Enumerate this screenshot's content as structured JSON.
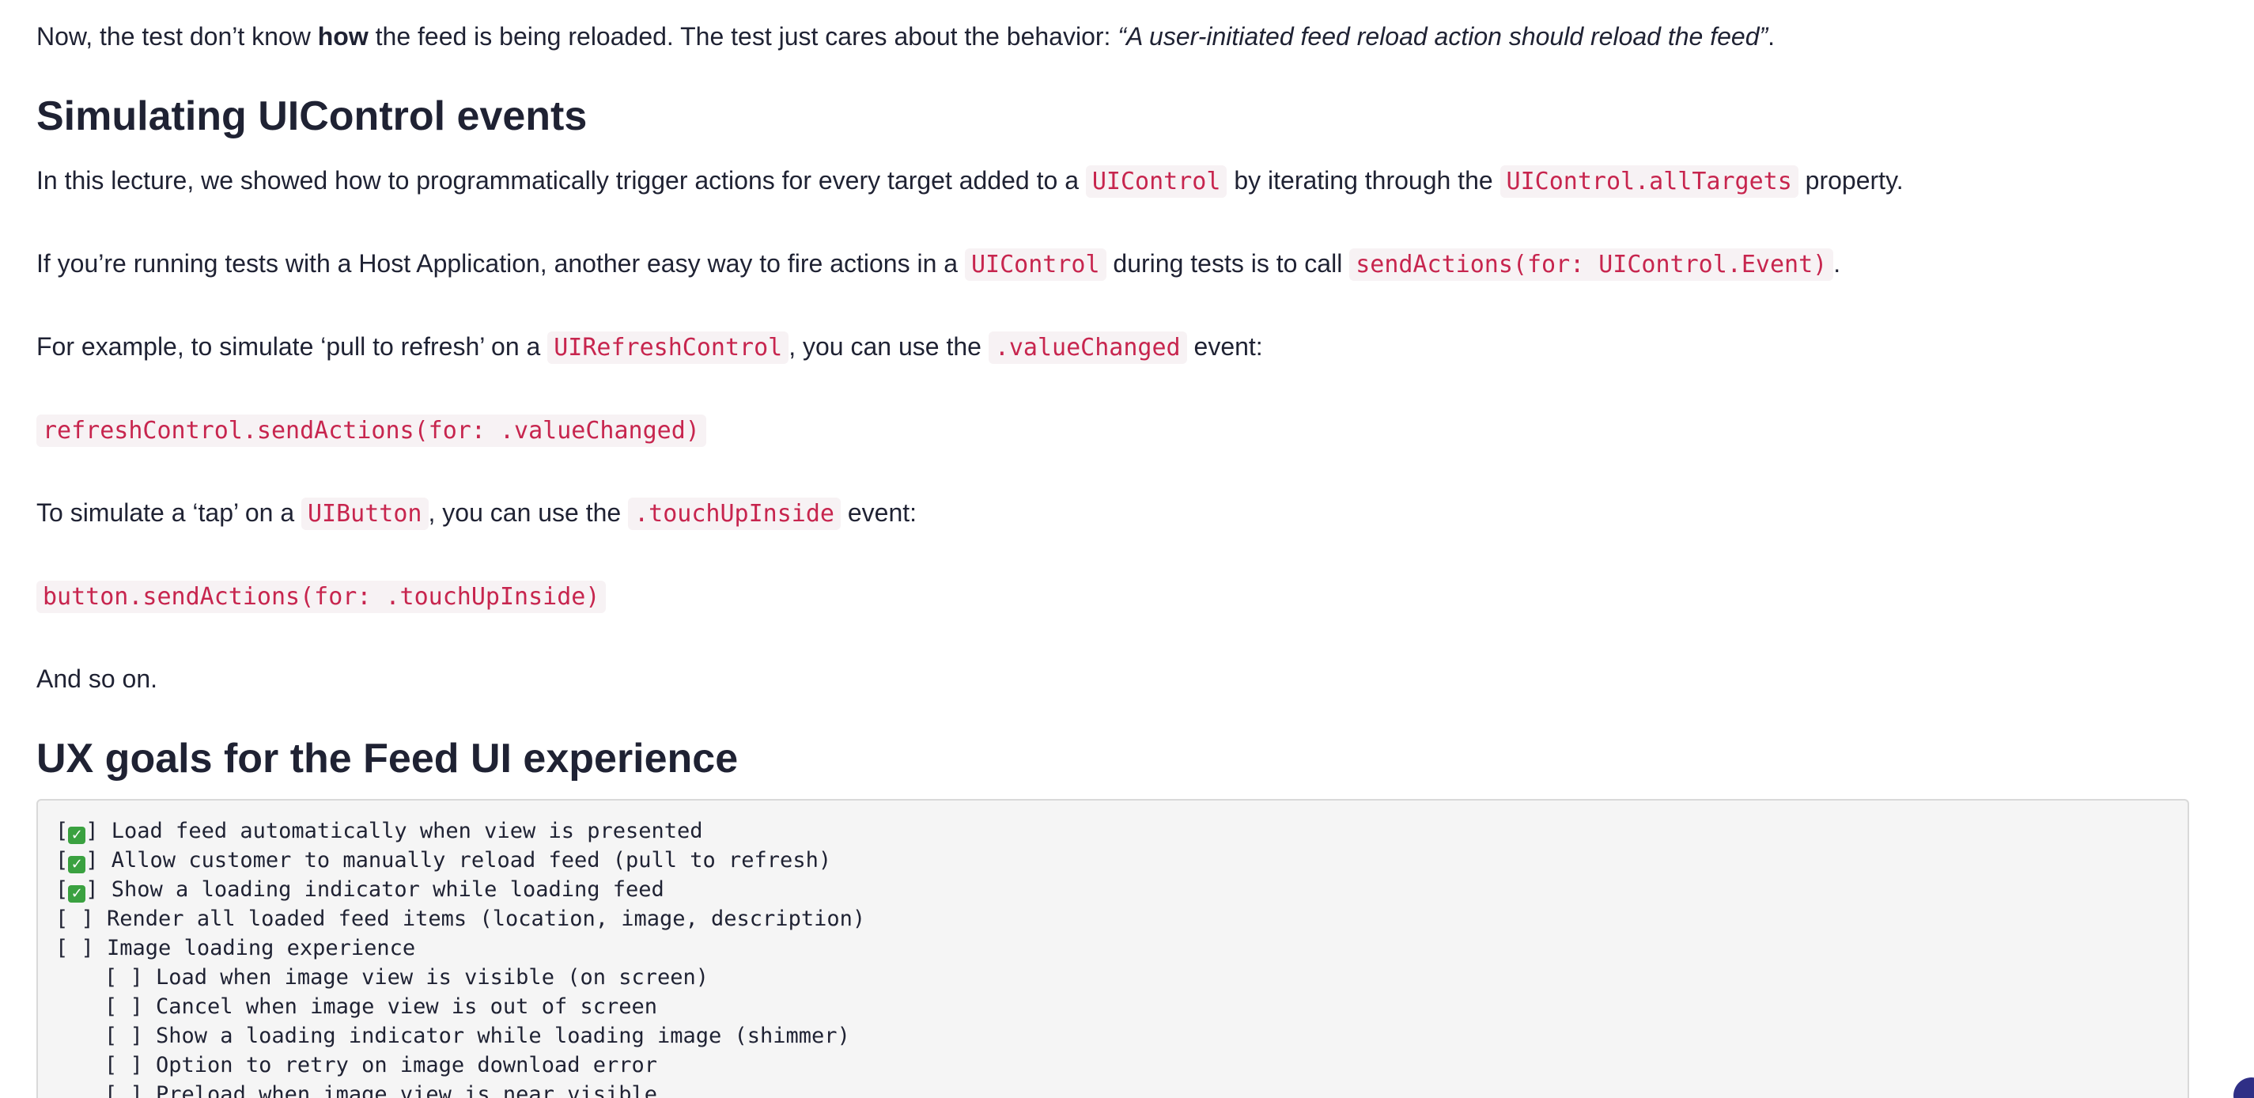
{
  "intro": {
    "pre": "Now, the test don’t know ",
    "bold": "how",
    "mid": " the feed is being reloaded. The test just cares about the behavior: ",
    "quote": "“A user-initiated feed reload action should reload the feed”",
    "end": "."
  },
  "section1": {
    "heading": "Simulating UIControl events",
    "p1": {
      "t1": "In this lecture, we showed how to programmatically trigger actions for every target added to a ",
      "c1": "UIControl",
      "t2": " by iterating through the ",
      "c2": "UIControl.allTargets",
      "t3": " property."
    },
    "p2": {
      "t1": "If you’re running tests with a Host Application, another easy way to fire actions in a ",
      "c1": "UIControl",
      "t2": " during tests is to call ",
      "c2": "sendActions(for: UIControl.Event)",
      "t3": "."
    },
    "p3": {
      "t1": "For example, to simulate ‘pull to refresh’ on a ",
      "c1": "UIRefreshControl",
      "t2": ", you can use the ",
      "c2": ".valueChanged",
      "t3": " event:"
    },
    "code1": "refreshControl.sendActions(for: .valueChanged)",
    "p4": {
      "t1": "To simulate a ‘tap’ on a ",
      "c1": "UIButton",
      "t2": ", you can use the ",
      "c2": ".touchUpInside",
      "t3": " event:"
    },
    "code2": "button.sendActions(for: .touchUpInside)",
    "p5": "And so on."
  },
  "section2": {
    "heading": "UX goals for the Feed UI experience",
    "items": [
      {
        "checked": true,
        "sub": false,
        "text": "Load feed automatically when view is presented"
      },
      {
        "checked": true,
        "sub": false,
        "text": "Allow customer to manually reload feed (pull to refresh)"
      },
      {
        "checked": true,
        "sub": false,
        "text": "Show a loading indicator while loading feed"
      },
      {
        "checked": false,
        "sub": false,
        "text": "Render all loaded feed items (location, image, description)"
      },
      {
        "checked": false,
        "sub": false,
        "text": "Image loading experience"
      },
      {
        "checked": false,
        "sub": true,
        "text": "Load when image view is visible (on screen)"
      },
      {
        "checked": false,
        "sub": true,
        "text": "Cancel when image view is out of screen"
      },
      {
        "checked": false,
        "sub": true,
        "text": "Show a loading indicator while loading image (shimmer)"
      },
      {
        "checked": false,
        "sub": true,
        "text": "Option to retry on image download error"
      },
      {
        "checked": false,
        "sub": true,
        "text": "Preload when image view is near visible"
      }
    ]
  }
}
